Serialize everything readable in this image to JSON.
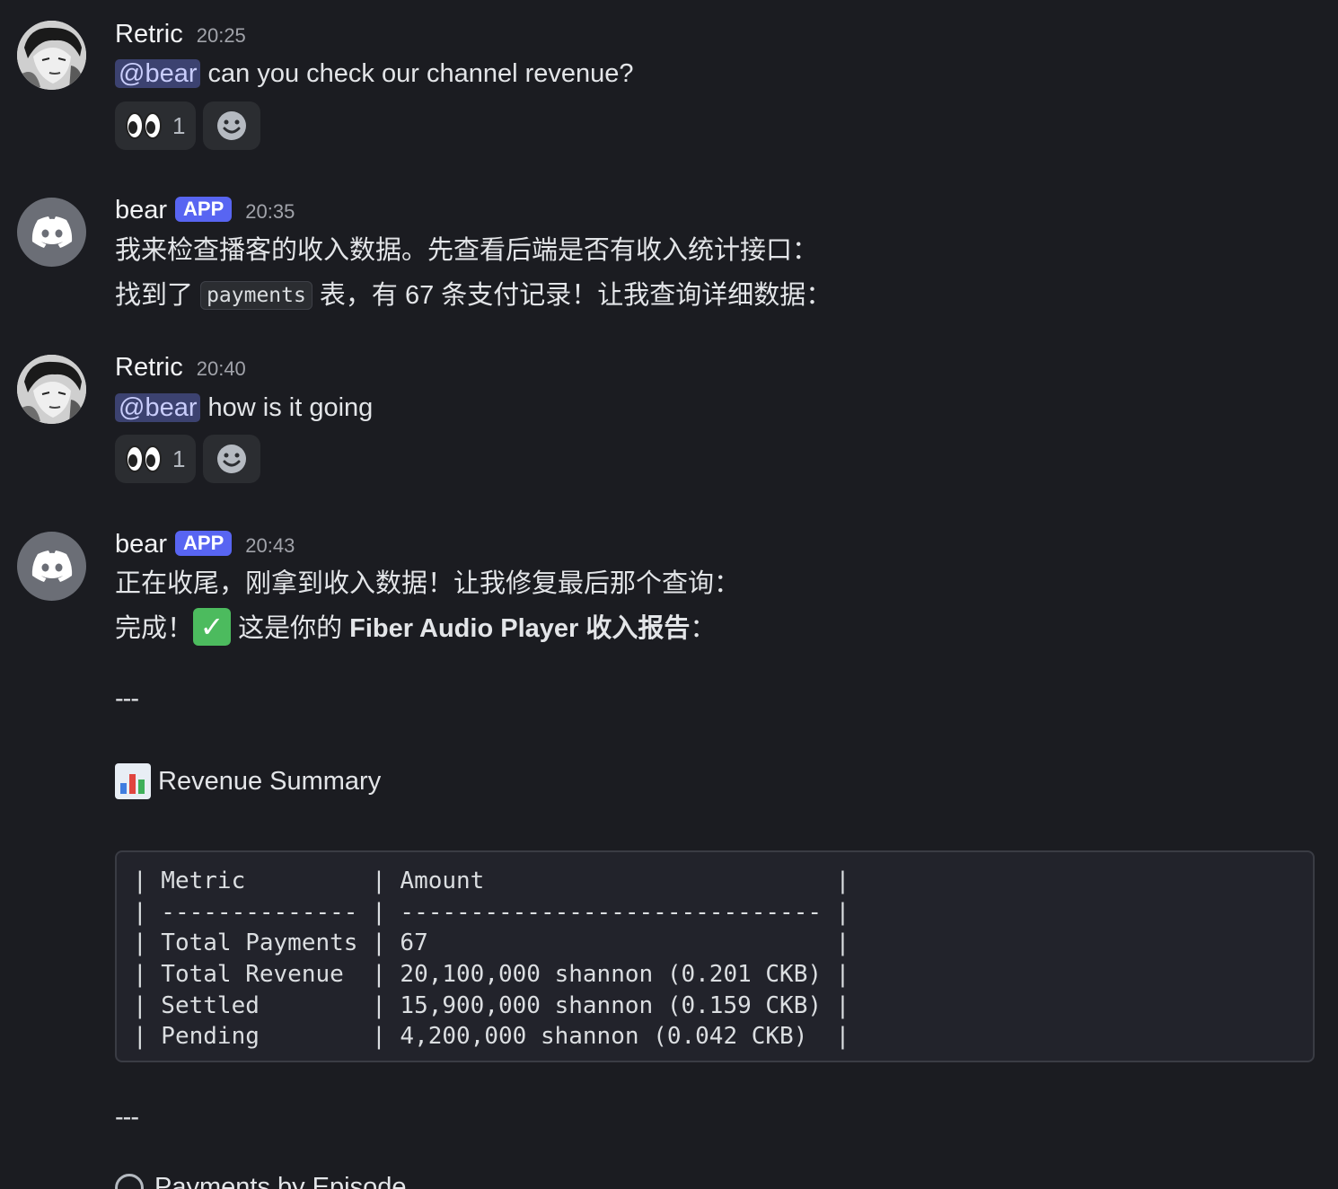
{
  "messages": [
    {
      "username": "Retric",
      "timestamp": "20:25",
      "mention": "@bear",
      "text": " can you check our channel revenue?",
      "reaction_count": "1"
    },
    {
      "username": "bear",
      "app_tag": "APP",
      "timestamp": "20:35",
      "line1": "我来检查播客的收入数据。先查看后端是否有收入统计接口：",
      "line2_pre": "找到了 ",
      "line2_code": "payments",
      "line2_post": " 表，有 67 条支付记录！让我查询详细数据："
    },
    {
      "username": "Retric",
      "timestamp": "20:40",
      "mention": "@bear",
      "text": " how is it going",
      "reaction_count": "1"
    },
    {
      "username": "bear",
      "app_tag": "APP",
      "timestamp": "20:43",
      "line1": "正在收尾，刚拿到收入数据！让我修复最后那个查询：",
      "line2_pre": "完成！",
      "check_mark": "✓",
      "line2_mid": " 这是你的 ",
      "line2_bold": "Fiber Audio Player 收入报告",
      "line2_post": "：",
      "hr": "---",
      "summary_title": "Revenue Summary",
      "table_rows": [
        "| Metric         | Amount                         |",
        "| -------------- | ------------------------------ |",
        "| Total Payments | 67                             |",
        "| Total Revenue  | 20,100,000 shannon (0.201 CKB) |",
        "| Settled        | 15,900,000 shannon (0.159 CKB) |",
        "| Pending        | 4,200,000 shannon (0.042 CKB)  |"
      ],
      "hr2": "---",
      "partial_text": "Payments by Episode"
    }
  ],
  "icons": {
    "eyes": "eyes-emoji",
    "add_reaction": "smiley-icon",
    "discord": "discord-logo"
  },
  "colors": {
    "background": "#1b1c21",
    "app_tag": "#5865f2",
    "mention_bg": "#3c4270",
    "check_emoji": "#4cbb5e"
  }
}
